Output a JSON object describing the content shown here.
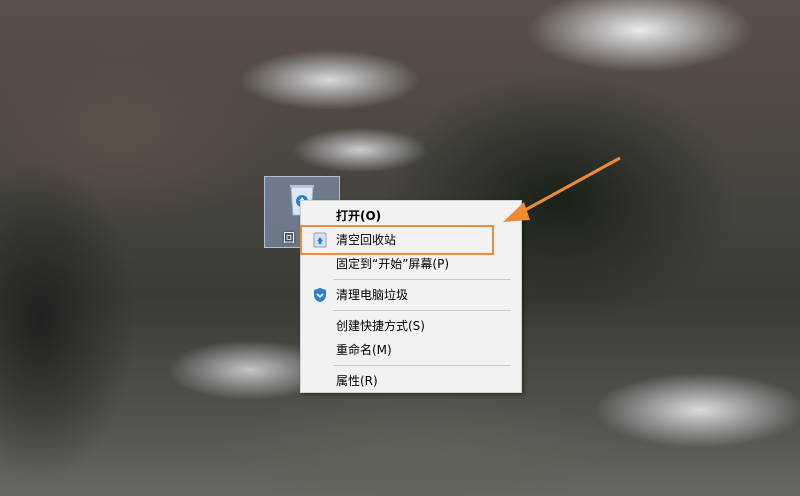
{
  "desktop": {
    "icon_label": "回",
    "icon_name": "recycle-bin-icon"
  },
  "context_menu": {
    "items": [
      {
        "label": "打开(O)",
        "bold": true
      },
      {
        "label": "清空回收站",
        "icon": "recycle-icon"
      },
      {
        "label": "固定到“开始”屏幕(P)"
      },
      {
        "label": "清理电脑垃圾",
        "icon": "shield-icon"
      },
      {
        "label": "创建快捷方式(S)"
      },
      {
        "label": "重命名(M)"
      },
      {
        "label": "属性(R)"
      }
    ]
  },
  "annotation": {
    "color": "#f08a34"
  }
}
